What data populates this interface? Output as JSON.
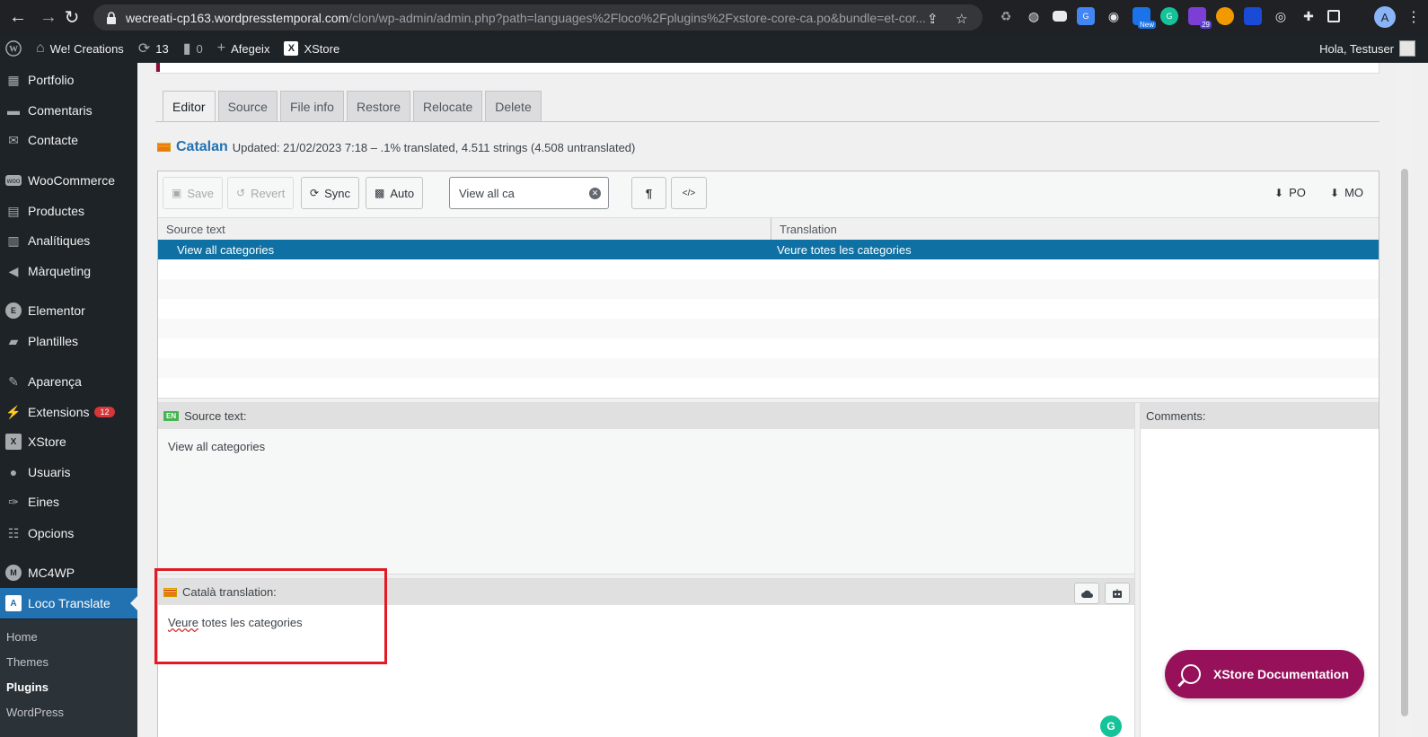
{
  "browser": {
    "url_host": "wecreati-cp163.wordpresstemporal.com",
    "url_path": "/clon/wp-admin/admin.php?path=languages%2Floco%2Fplugins%2Fxstore-core-ca.po&bundle=et-cor...",
    "extension_badge_new": "New",
    "extension_badge_count": "29",
    "profile_initial": "A"
  },
  "adminbar": {
    "site_name": "We! Creations",
    "updates_count": "13",
    "comments_count": "0",
    "add_new": "Afegeix",
    "xstore": "XStore",
    "greeting": "Hola, Testuser"
  },
  "sidebar": {
    "items": [
      {
        "label": "Portfolio",
        "icon": "portfolio-icon"
      },
      {
        "label": "Comentaris",
        "icon": "comment-icon"
      },
      {
        "label": "Contacte",
        "icon": "mail-icon"
      },
      {
        "label": "WooCommerce",
        "icon": "woo-icon"
      },
      {
        "label": "Productes",
        "icon": "archive-icon"
      },
      {
        "label": "Analítiques",
        "icon": "chart-icon"
      },
      {
        "label": "Màrqueting",
        "icon": "megaphone-icon"
      },
      {
        "label": "Elementor",
        "icon": "elementor-icon"
      },
      {
        "label": "Plantilles",
        "icon": "folder-icon"
      },
      {
        "label": "Aparença",
        "icon": "brush-icon"
      },
      {
        "label": "Extensions",
        "icon": "plugin-icon",
        "count": "12"
      },
      {
        "label": "XStore",
        "icon": "xstore-icon"
      },
      {
        "label": "Usuaris",
        "icon": "user-icon"
      },
      {
        "label": "Eines",
        "icon": "wrench-icon"
      },
      {
        "label": "Opcions",
        "icon": "settings-icon"
      },
      {
        "label": "MC4WP",
        "icon": "mc4wp-icon"
      },
      {
        "label": "Loco Translate",
        "icon": "translate-icon"
      }
    ],
    "submenu": [
      "Home",
      "Themes",
      "Plugins",
      "WordPress"
    ]
  },
  "tabs": [
    "Editor",
    "Source",
    "File info",
    "Restore",
    "Relocate",
    "Delete"
  ],
  "locale": {
    "name": "Catalan",
    "summary": "Updated: 21/02/2023 7:18 – .1% translated, 4.511 strings (4.508 untranslated)"
  },
  "toolbar": {
    "save": "Save",
    "revert": "Revert",
    "sync": "Sync",
    "auto": "Auto",
    "search_value": "View all ca",
    "pilcrow": "¶",
    "code": "</>",
    "po": "PO",
    "mo": "MO"
  },
  "grid": {
    "col_source": "Source text",
    "col_translation": "Translation",
    "rows": [
      {
        "source": "View all categories",
        "translation": "Veure totes les categories"
      }
    ]
  },
  "source_pane": {
    "lang_code": "EN",
    "label": "Source text:",
    "text": "View all categories"
  },
  "comments_pane": {
    "label": "Comments:"
  },
  "translation_pane": {
    "label": "Català translation:",
    "text_misspelled": "Veure",
    "text_rest": " totes les categories"
  },
  "xstore_doc": "XStore Documentation",
  "colors": {
    "wp_dark": "#1d2327",
    "wp_blue": "#2271b1",
    "selection": "#0f71a3",
    "xstore_brand": "#96105a",
    "highlight": "#e01b24"
  }
}
